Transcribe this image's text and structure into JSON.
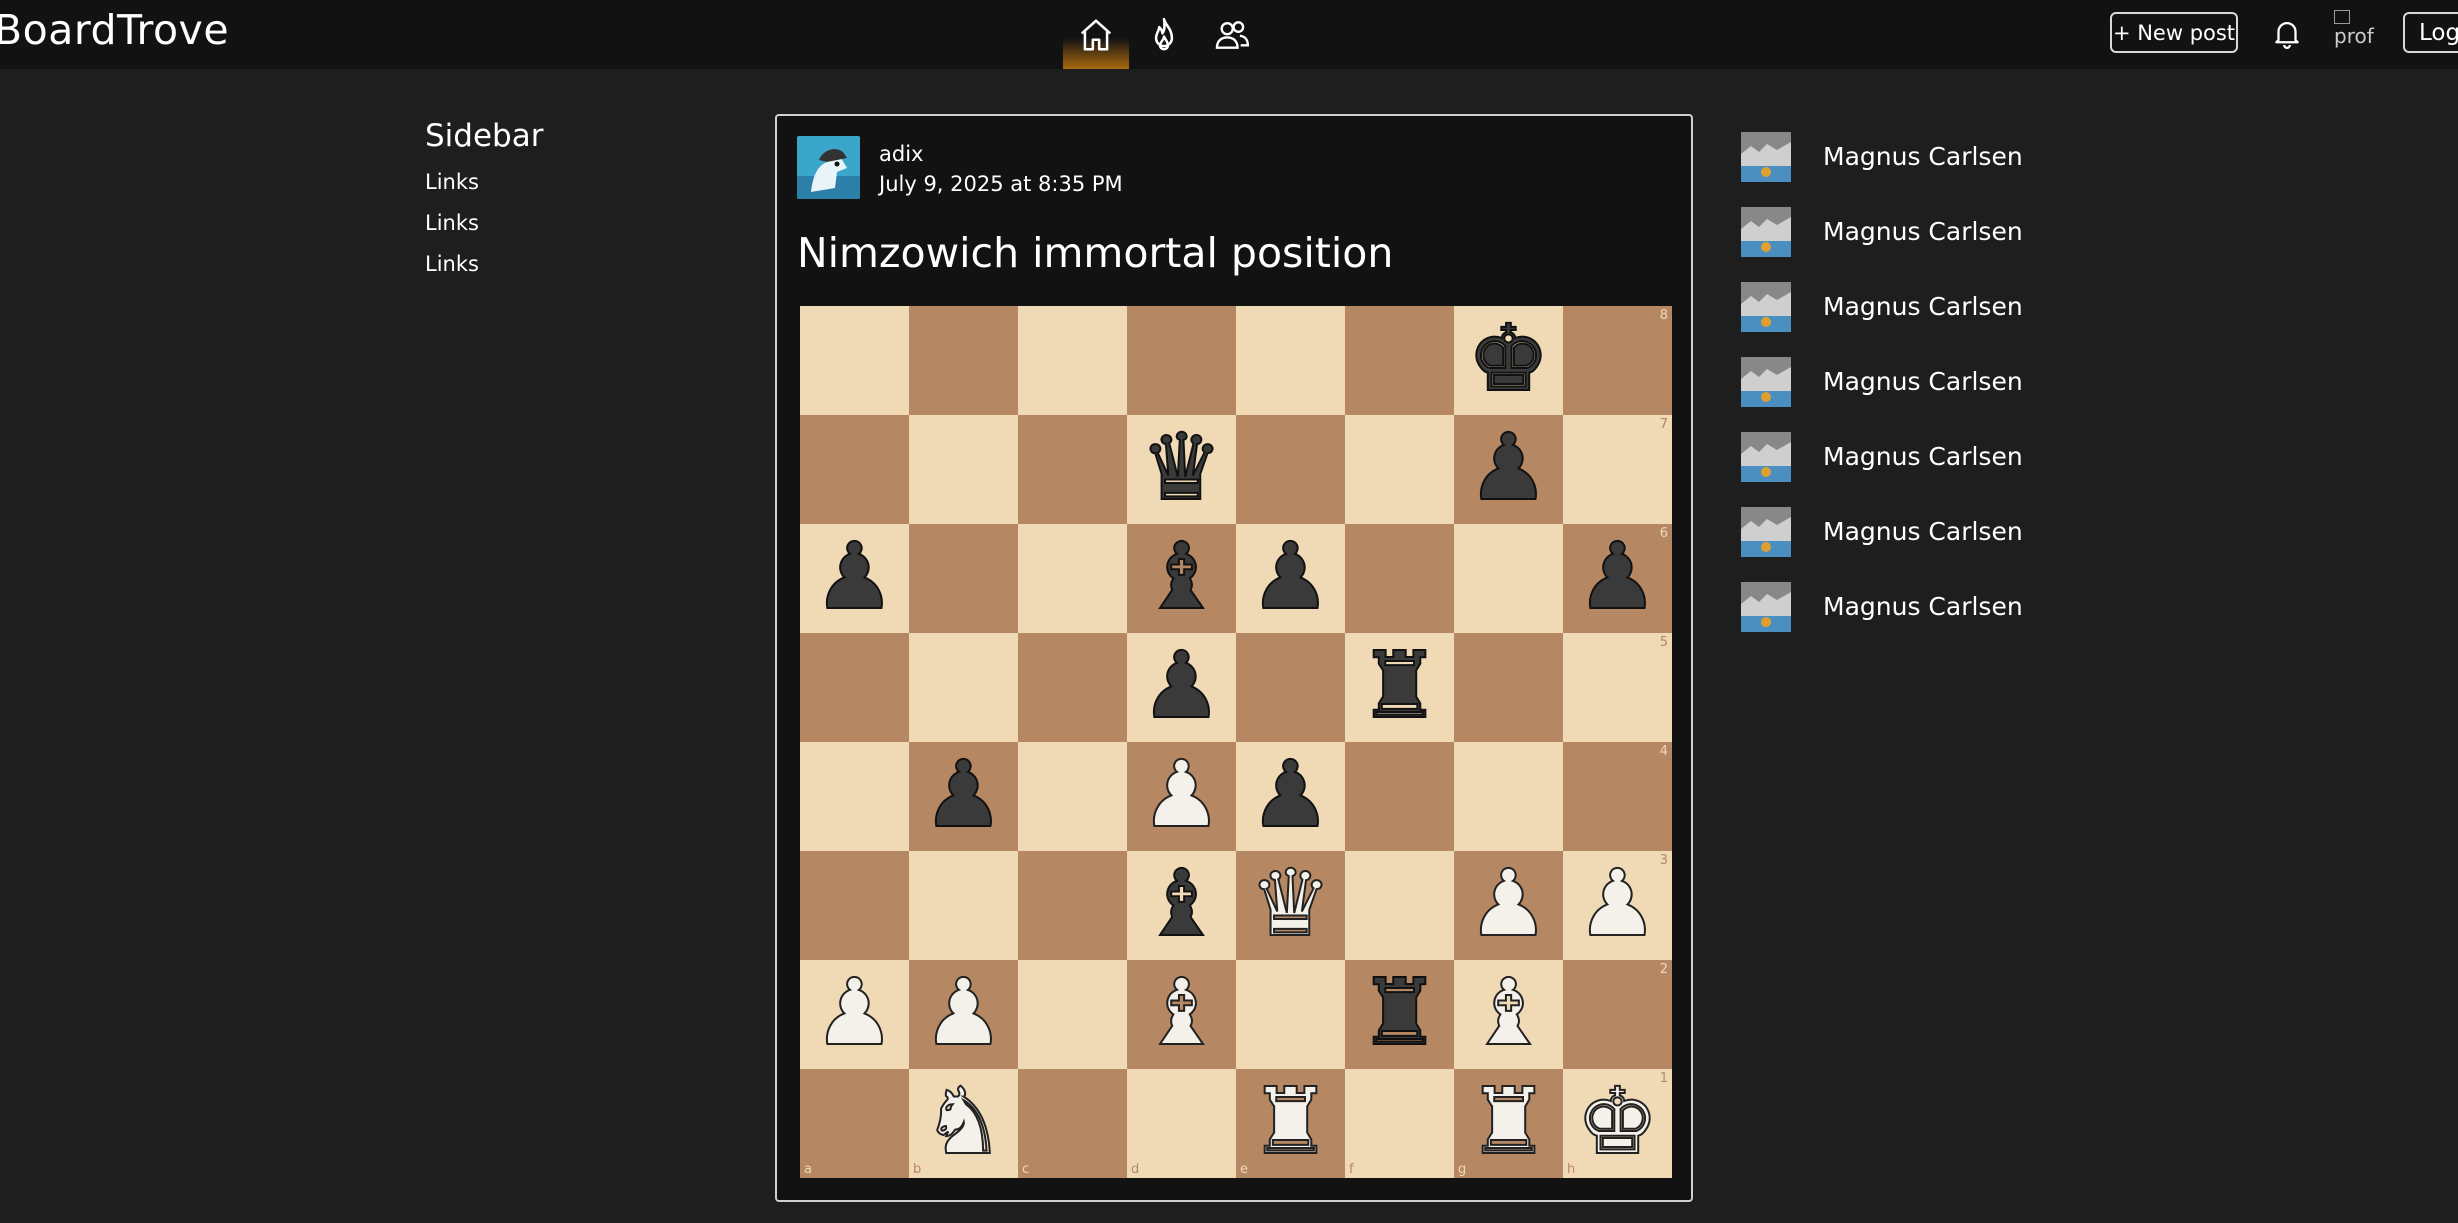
{
  "app": {
    "brand": "BoardTrove",
    "nav_tabs": [
      {
        "name": "home",
        "icon": "home-icon",
        "active": true
      },
      {
        "name": "hot",
        "icon": "flame-icon",
        "active": false
      },
      {
        "name": "community",
        "icon": "users-icon",
        "active": false
      }
    ],
    "new_post_label": "+ New post",
    "profile_alt": "prof",
    "login_label": "Login",
    "accent_color": "#a86a10"
  },
  "sidebar": {
    "title": "Sidebar",
    "links": [
      "Links",
      "Links",
      "Links"
    ]
  },
  "post": {
    "author": "adix",
    "date": "July 9, 2025 at 8:35 PM",
    "title": "Nimzowich immortal position",
    "board": {
      "files": [
        "a",
        "b",
        "c",
        "d",
        "e",
        "f",
        "g",
        "h"
      ],
      "ranks": [
        "8",
        "7",
        "6",
        "5",
        "4",
        "3",
        "2",
        "1"
      ],
      "light_color": "#f0d9b5",
      "dark_color": "#b58863",
      "position": [
        [
          "",
          "",
          "",
          "",
          "",
          "",
          "bK",
          ""
        ],
        [
          "",
          "",
          "",
          "bQ",
          "",
          "",
          "bP",
          ""
        ],
        [
          "bP",
          "",
          "",
          "bB",
          "bP",
          "",
          "",
          "bP"
        ],
        [
          "",
          "",
          "",
          "bP",
          "",
          "bR",
          "",
          ""
        ],
        [
          "",
          "bP",
          "",
          "wP",
          "bP",
          "",
          "",
          ""
        ],
        [
          "",
          "",
          "",
          "bB",
          "wQ",
          "",
          "wP",
          "wP"
        ],
        [
          "wP",
          "wP",
          "",
          "wB",
          "",
          "bR",
          "wB",
          ""
        ],
        [
          "",
          "wN",
          "",
          "",
          "wR",
          "",
          "wR",
          "wK"
        ]
      ]
    }
  },
  "right_list": {
    "people": [
      {
        "name": "Magnus Carlsen"
      },
      {
        "name": "Magnus Carlsen"
      },
      {
        "name": "Magnus Carlsen"
      },
      {
        "name": "Magnus Carlsen"
      },
      {
        "name": "Magnus Carlsen"
      },
      {
        "name": "Magnus Carlsen"
      },
      {
        "name": "Magnus Carlsen"
      }
    ]
  }
}
